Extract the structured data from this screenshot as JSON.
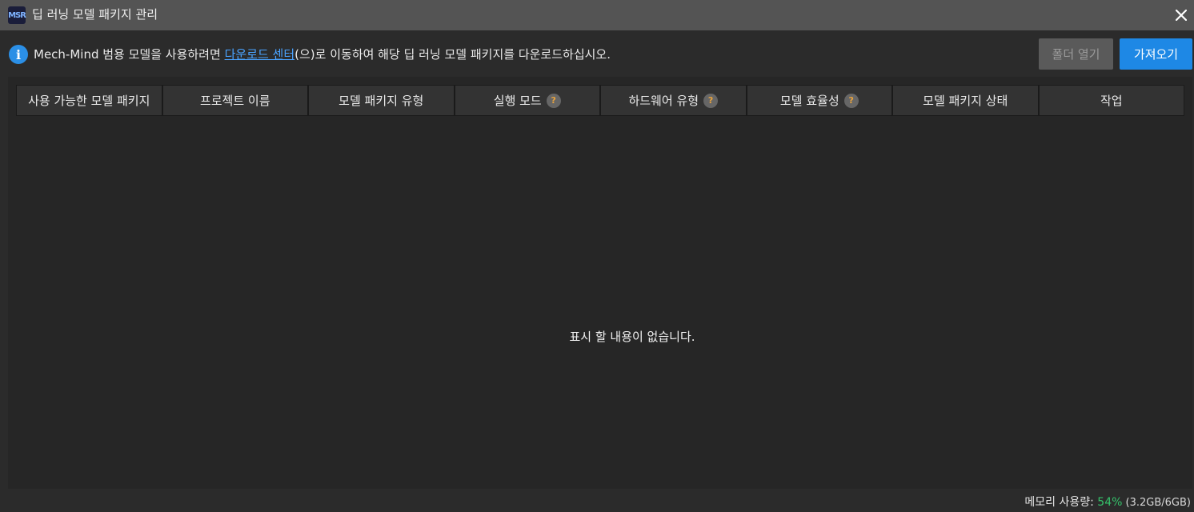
{
  "window": {
    "logo_text": "MSR",
    "title": "딥 러닝 모델 패키지 관리",
    "close_glyph": "✕"
  },
  "info": {
    "icon_glyph": "i",
    "text_before": "Mech-Mind 범용 모델을 사용하려면 ",
    "link": "다운로드 센터",
    "text_after": "(으)로 이동하여 해당 딥 러닝 모델 패키지를 다운로드하십시오."
  },
  "buttons": {
    "open_folder": "폴더 열기",
    "import": "가져오기"
  },
  "table": {
    "columns": [
      {
        "label": "사용 가능한 모델 패키지",
        "help": false
      },
      {
        "label": "프로젝트 이름",
        "help": false
      },
      {
        "label": "모델 패키지 유형",
        "help": false
      },
      {
        "label": "실행 모드",
        "help": true
      },
      {
        "label": "하드웨어 유형",
        "help": true
      },
      {
        "label": "모델 효율성",
        "help": true
      },
      {
        "label": "모델 패키지 상태",
        "help": false
      },
      {
        "label": "작업",
        "help": false
      }
    ],
    "help_glyph": "?",
    "empty_message": "표시 할 내용이 없습니다."
  },
  "status": {
    "memory_label": "메모리 사용량: ",
    "memory_percent": "54%",
    "memory_detail": " (3.2GB/6GB)"
  },
  "colors": {
    "accent": "#1e88e5",
    "link": "#4aa3ff",
    "memory_ok": "#35c26b"
  }
}
